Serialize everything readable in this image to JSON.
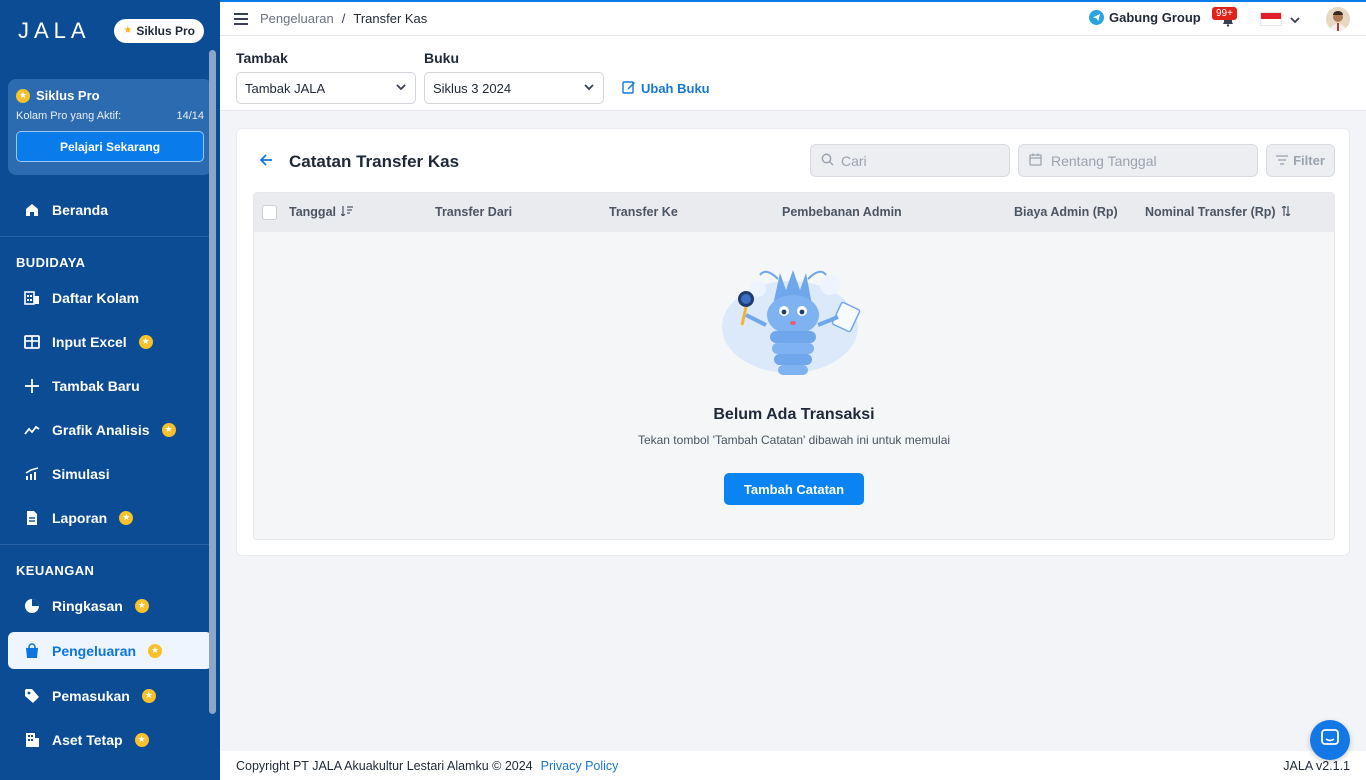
{
  "sidebar": {
    "logo": "JALA",
    "plan_pill": "Siklus Pro",
    "pro_card": {
      "title": "Siklus Pro",
      "active_label": "Kolam Pro yang Aktif:",
      "active_count": "14/14",
      "cta": "Pelajari Sekarang"
    },
    "home": "Beranda",
    "section_budidaya": "BUDIDAYA",
    "budidaya_items": [
      {
        "label": "Daftar Kolam",
        "icon": "pond-list-icon",
        "pro": false
      },
      {
        "label": "Input Excel",
        "icon": "table-icon",
        "pro": true
      },
      {
        "label": "Tambak Baru",
        "icon": "plus-icon",
        "pro": false
      },
      {
        "label": "Grafik Analisis",
        "icon": "trend-line-icon",
        "pro": true
      },
      {
        "label": "Simulasi",
        "icon": "simulation-chart-icon",
        "pro": false
      },
      {
        "label": "Laporan",
        "icon": "report-file-icon",
        "pro": true
      }
    ],
    "section_keuangan": "KEUANGAN",
    "keuangan_items": [
      {
        "label": "Ringkasan",
        "icon": "pie-chart-icon",
        "pro": true
      },
      {
        "label": "Pengeluaran",
        "icon": "shopping-bag-icon",
        "pro": true,
        "active": true
      },
      {
        "label": "Pemasukan",
        "icon": "tag-icon",
        "pro": true
      },
      {
        "label": "Aset Tetap",
        "icon": "building-icon",
        "pro": true
      }
    ]
  },
  "topbar": {
    "breadcrumb_parent": "Pengeluaran",
    "breadcrumb_sep": "/",
    "breadcrumb_current": "Transfer Kas",
    "group_link": "Gabung Group",
    "notification_badge": "99+"
  },
  "filters": {
    "tambak_label": "Tambak",
    "tambak_value": "Tambak JALA",
    "buku_label": "Buku",
    "buku_value": "Siklus 3 2024",
    "edit_book": "Ubah Buku"
  },
  "card": {
    "title": "Catatan Transfer Kas",
    "search_placeholder": "Cari",
    "date_range_placeholder": "Rentang Tanggal",
    "filter_label": "Filter",
    "columns": [
      "Tanggal",
      "Transfer Dari",
      "Transfer Ke",
      "Pembebanan Admin",
      "Biaya Admin (Rp)",
      "Nominal Transfer (Rp)"
    ],
    "empty_title": "Belum Ada Transaksi",
    "empty_subtitle": "Tekan tombol 'Tambah Catatan' dibawah ini untuk memulai",
    "add_button": "Tambah Catatan"
  },
  "footer": {
    "copyright": "Copyright PT JALA Akuakultur Lestari Alamku © 2024",
    "privacy": "Privacy Policy",
    "version": "JALA v2.1.1"
  },
  "colors": {
    "sidebar": "#0b4c94",
    "accent": "#0a84f2",
    "pro_star": "#f6c12b",
    "badge": "#e0231b"
  }
}
